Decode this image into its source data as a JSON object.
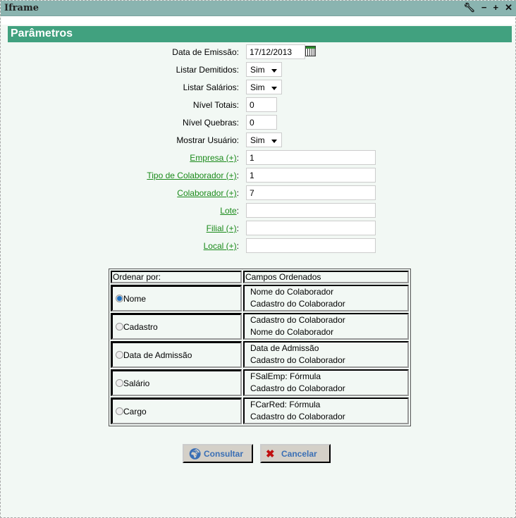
{
  "window": {
    "title": "Iframe",
    "controls": [
      "wrench",
      "minimize",
      "maximize",
      "close"
    ]
  },
  "panel": {
    "title": "Parâmetros"
  },
  "fields": [
    {
      "label": "Data de Emissão:",
      "type": "date",
      "value": "17/12/2013",
      "link": false
    },
    {
      "label": "Listar Demitidos:",
      "type": "select",
      "value": "Sim",
      "link": false
    },
    {
      "label": "Listar Salários:",
      "type": "select",
      "value": "Sim",
      "link": false
    },
    {
      "label": "Nível Totais:",
      "type": "small",
      "value": "0",
      "link": false
    },
    {
      "label": "Nível Quebras:",
      "type": "small",
      "value": "0",
      "link": false
    },
    {
      "label": "Mostrar Usuário:",
      "type": "select",
      "value": "Sim",
      "link": false
    },
    {
      "label": "Empresa (+)",
      "type": "text",
      "value": "1",
      "link": true
    },
    {
      "label": "Tipo de Colaborador (+)",
      "type": "text",
      "value": "1",
      "link": true
    },
    {
      "label": "Colaborador (+)",
      "type": "text",
      "value": "7",
      "link": true
    },
    {
      "label": "Lote",
      "type": "text",
      "value": "",
      "link": true
    },
    {
      "label": "Filial (+)",
      "type": "text",
      "value": "",
      "link": true
    },
    {
      "label": "Local (+)",
      "type": "text",
      "value": "",
      "link": true
    }
  ],
  "order_table": {
    "headers": [
      "Ordenar por:",
      "Campos Ordenados"
    ],
    "rows": [
      {
        "option": "Nome",
        "checked": true,
        "fields": [
          "Nome do Colaborador",
          "Cadastro do Colaborador"
        ]
      },
      {
        "option": "Cadastro",
        "checked": false,
        "fields": [
          "Cadastro do Colaborador",
          "Nome do Colaborador"
        ]
      },
      {
        "option": "Data de Admissão",
        "checked": false,
        "fields": [
          "Data de Admissão",
          "Cadastro do Colaborador"
        ]
      },
      {
        "option": "Salário",
        "checked": false,
        "fields": [
          "FSalEmp: Fórmula",
          "Cadastro do Colaborador"
        ]
      },
      {
        "option": "Cargo",
        "checked": false,
        "fields": [
          "FCarRed: Fórmula",
          "Cadastro do Colaborador"
        ]
      }
    ]
  },
  "buttons": {
    "consultar": "Consultar",
    "cancelar": "Cancelar"
  }
}
